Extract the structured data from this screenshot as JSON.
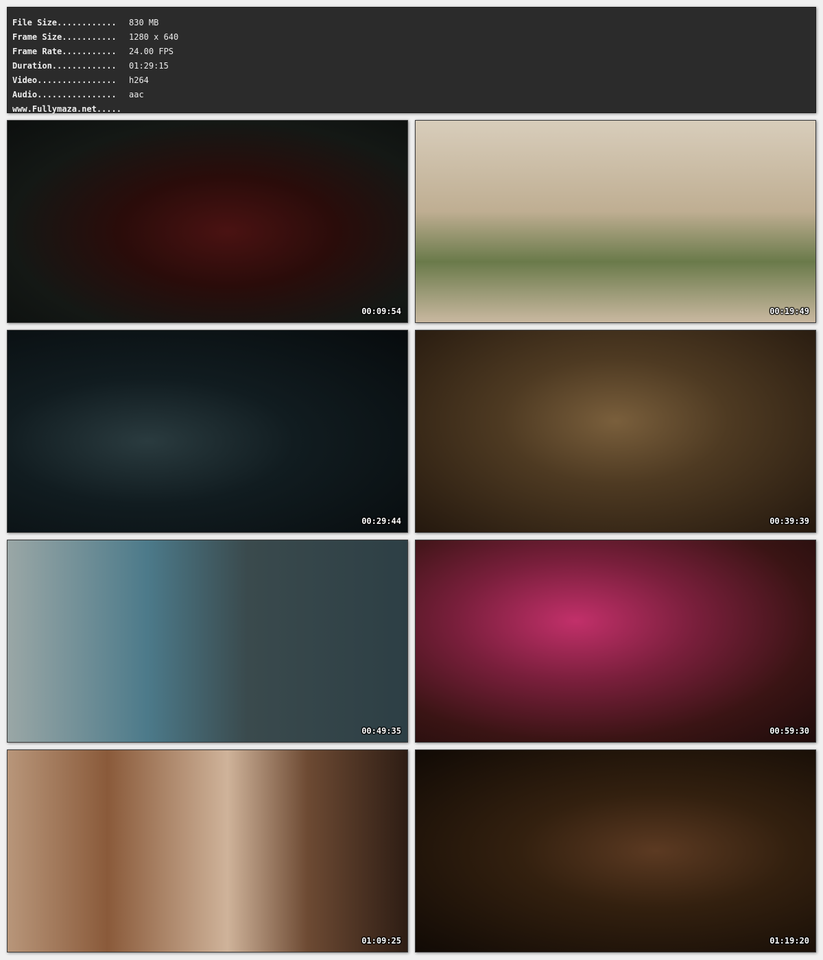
{
  "info": [
    {
      "key": "File Size............",
      "value": "830 MB"
    },
    {
      "key": "Frame Size...........",
      "value": "1280 x 640"
    },
    {
      "key": "Frame Rate...........",
      "value": "24.00 FPS"
    },
    {
      "key": "Duration.............",
      "value": "01:29:15"
    },
    {
      "key": "Video................",
      "value": "h264"
    },
    {
      "key": "Audio................",
      "value": "aac"
    },
    {
      "key": "www.Fullymaza.net.....",
      "value": ""
    }
  ],
  "thumbnails": [
    {
      "timestamp": "00:09:54"
    },
    {
      "timestamp": "00:19:49"
    },
    {
      "timestamp": "00:29:44"
    },
    {
      "timestamp": "00:39:39"
    },
    {
      "timestamp": "00:49:35"
    },
    {
      "timestamp": "00:59:30"
    },
    {
      "timestamp": "01:09:25"
    },
    {
      "timestamp": "01:19:20"
    }
  ]
}
